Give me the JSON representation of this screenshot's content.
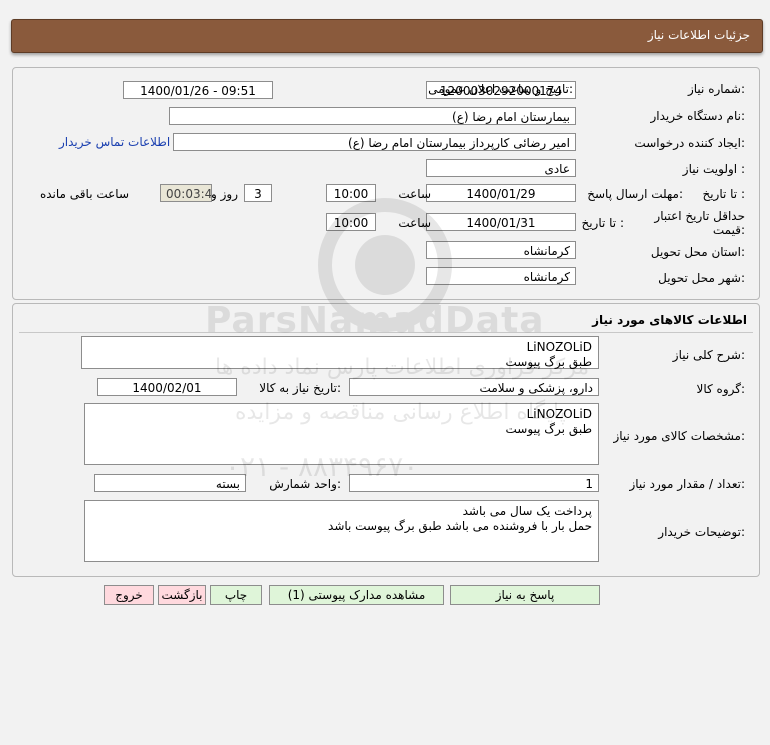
{
  "header": {
    "title": "جزئیات اطلاعات نیاز"
  },
  "need": {
    "number_label": "شماره نیاز:",
    "number_value": "1200030292000174",
    "announce_label": "تاریخ و ساعت اعلان عمومی:",
    "announce_value": "1400/01/26 - 09:51",
    "buyer_org_label": "نام دستگاه خریدار:",
    "buyer_org_value": "بیمارستان امام رضا (ع)",
    "requester_label": "ایجاد کننده درخواست:",
    "requester_value": "امیر رضائی کارپرداز بیمارستان امام رضا (ع)",
    "contact_link": "اطلاعات تماس خریدار",
    "priority_label": "اولویت نیاز :",
    "priority_value": "عادی",
    "deadline_label": "مهلت ارسال پاسخ:",
    "to_date_label": "تا تاریخ :",
    "deadline_date": "1400/01/29",
    "time_label": "ساعت",
    "deadline_time": "10:00",
    "days_value": "3",
    "days_label": "روز و",
    "remaining_value": "00:03:44",
    "remaining_label": "ساعت باقی مانده",
    "price_validity_label": "حداقل تاریخ اعتبار قیمت:",
    "validity_to_label": "تا تاریخ :",
    "validity_date": "1400/01/31",
    "validity_time_label": "ساعت",
    "validity_time": "10:00",
    "province_label": "استان محل تحویل:",
    "province_value": "کرمانشاه",
    "city_label": "شهر محل تحویل:",
    "city_value": "کرمانشاه"
  },
  "goods": {
    "section_title": "اطلاعات کالاهای مورد نیاز",
    "summary_label": "شرح کلی نیاز:",
    "summary_line1": "LiNOZOLiD",
    "summary_line2": "طبق برگ پیوست",
    "group_label": "گروه کالا:",
    "group_value": "دارو، پزشکی و سلامت",
    "need_date_label": "تاریخ نیاز به کالا:",
    "need_date_value": "1400/02/01",
    "specs_label": "مشخصات کالای مورد نیاز:",
    "specs_line1": "LiNOZOLiD",
    "specs_line2": "طبق برگ پیوست",
    "qty_label": "تعداد / مقدار مورد نیاز:",
    "qty_value": "1",
    "unit_label": "واحد شمارش:",
    "unit_value": "بسته",
    "buyer_notes_label": "توضیحات خریدار:",
    "notes_line1": "پرداخت یک سال می باشد",
    "notes_line2": "حمل بار با فروشنده می باشد طبق برگ پیوست باشد"
  },
  "buttons": {
    "reply": "پاسخ به نیاز",
    "attachments": "مشاهده مدارک پیوستی (1)",
    "print": "چاپ",
    "back": "بازگشت",
    "exit": "خروج"
  },
  "watermark": {
    "brand": "ParsNamadData",
    "line1": "مرکز فراوری اطلاعات پارس نماد داده ها",
    "line2": "پایگاه اطلاع رسانی مناقصه و مزایده",
    "phone": "۰۲۱ - ۸۸۳۴۹۶۷۰"
  },
  "colors": {
    "title_bar": "#8a5a3c",
    "link": "#1a3fb0",
    "reply_button": "#dff5d9",
    "exit_button": "#ffd9de"
  }
}
